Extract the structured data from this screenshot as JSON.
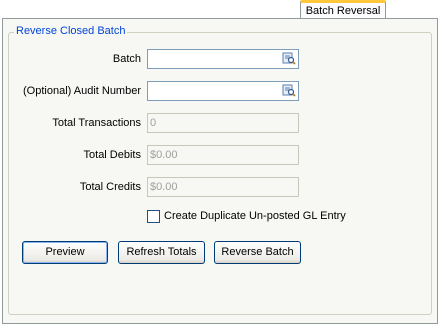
{
  "tab": {
    "label": "Batch Reversal"
  },
  "group": {
    "title": "Reverse Closed Batch"
  },
  "fields": [
    {
      "label": "Batch",
      "value": ""
    },
    {
      "label": "(Optional) Audit Number",
      "value": ""
    },
    {
      "label": "Total Transactions",
      "value": "0"
    },
    {
      "label": "Total Debits",
      "value": "$0.00"
    },
    {
      "label": "Total Credits",
      "value": "$0.00"
    }
  ],
  "checkbox": {
    "label": "Create Duplicate Un-posted GL Entry",
    "checked": false
  },
  "buttons": {
    "preview": "Preview",
    "refresh": "Refresh Totals",
    "reverse": "Reverse Batch"
  },
  "icons": {
    "lookup": "search-lookup-icon"
  },
  "colors": {
    "accent": "#0046d5",
    "tab_highlight": "#ffc83c"
  }
}
